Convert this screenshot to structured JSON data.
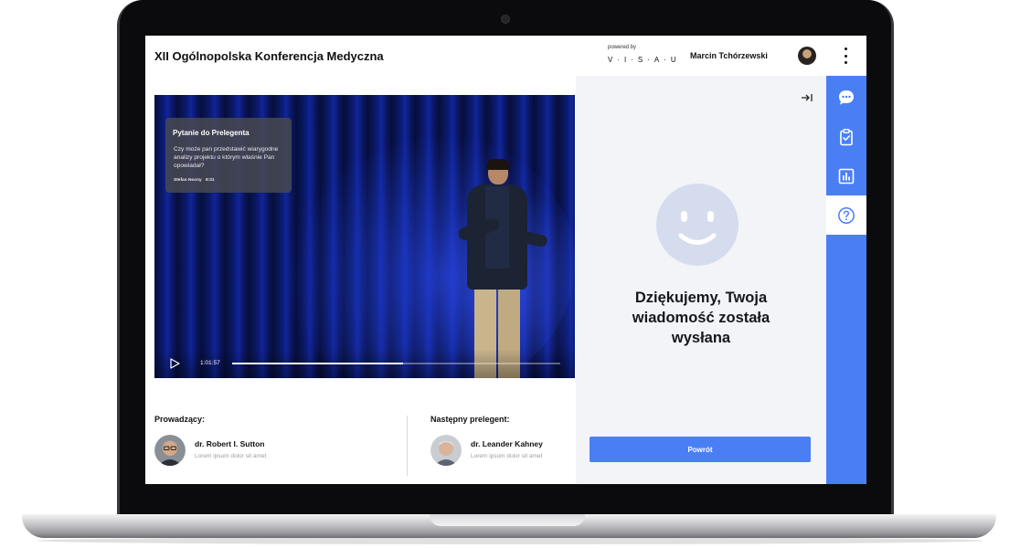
{
  "app": {
    "title": "XII Ogólnopolska Konferencja Medyczna",
    "powered_by": "powered by",
    "brand": "V·I·S·A·U"
  },
  "user": {
    "name": "Marcin Tchórzewski"
  },
  "video": {
    "question": {
      "title": "Pytanie do Prelegenta",
      "text": "Czy może pan przedstawić wiarygodne analizy projektu o którym właśnie Pan opowiadał?",
      "author": "Stefan Nocny",
      "time": "8:31"
    },
    "time": "1:01:57",
    "progress": 0.52
  },
  "host": {
    "label": "Prowadzący:",
    "name": "dr. Robert I. Sutton",
    "description": "Lorem ipsum dolor sit amet"
  },
  "next_speaker": {
    "label": "Następny prelegent:",
    "name": "dr. Leander Kahney",
    "description": "Lorem ipsum dolor sit amet"
  },
  "panel": {
    "message": "Dziękujemy, Twoja wiadomość została wysłana",
    "back_label": "Powrót"
  },
  "rail": {
    "items": [
      {
        "icon": "chat-icon"
      },
      {
        "icon": "clipboard-check-icon"
      },
      {
        "icon": "bar-chart-icon"
      },
      {
        "icon": "question-icon",
        "active": true
      }
    ]
  },
  "colors": {
    "accent": "#4a7ff4",
    "panel_bg": "#f3f4f7",
    "smiley": "#d5dcee"
  }
}
